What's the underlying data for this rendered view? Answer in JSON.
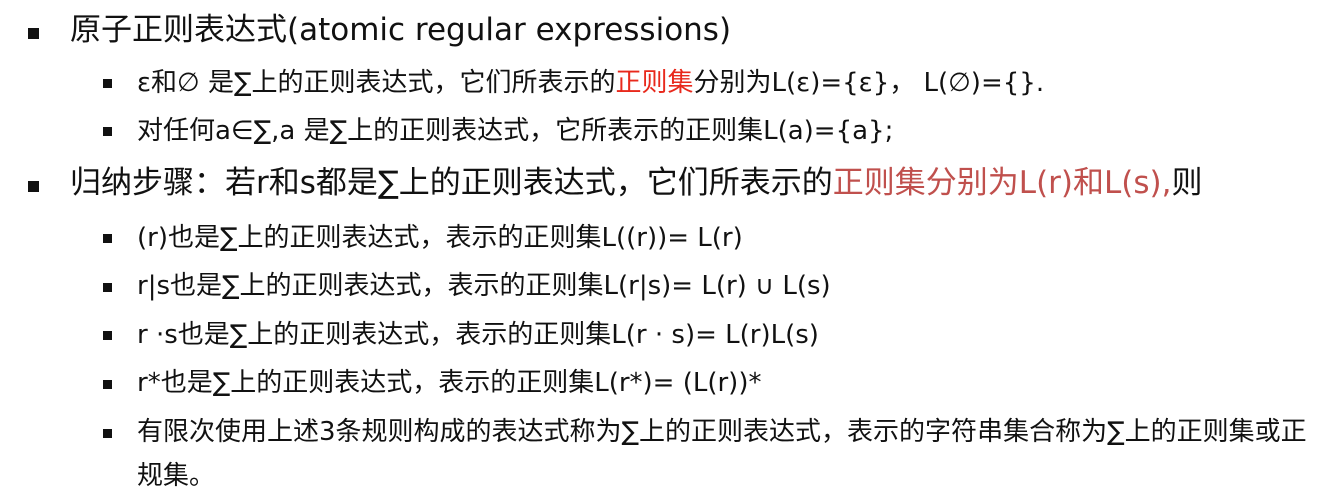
{
  "colors": {
    "text": "#111111",
    "highlight_red": "#e8291c",
    "highlight_rust": "#c0504d",
    "bullet": "#111111"
  },
  "atomic": {
    "title": "原子正则表达式(atomic regular expressions)",
    "item1": {
      "pre": "ε和∅ 是∑上的正则表达式，它们所表示的",
      "highlight": "正则集",
      "post": "分别为L(ε)={ε}， L(∅)={}."
    },
    "item2": "对任何a∈∑,a 是∑上的正则表达式，它所表示的正则集L(a)={a};"
  },
  "inductive": {
    "title": {
      "pre": "归纳步骤：若r和s都是∑上的正则表达式，它们所表示的",
      "highlight": "正则集分别为L(r)和L(s),",
      "post": "则"
    },
    "items": [
      "(r)也是∑上的正则表达式，表示的正则集L((r))= L(r)",
      "r|s也是∑上的正则表达式，表示的正则集L(r|s)= L(r) ∪ L(s)",
      "r ·s也是∑上的正则表达式，表示的正则集L(r · s)= L(r)L(s)",
      "r*也是∑上的正则表达式，表示的正则集L(r*)= (L(r))*",
      "有限次使用上述3条规则构成的表达式称为∑上的正则表达式，表示的字符串集合称为∑上的正则集或正规集。"
    ]
  }
}
